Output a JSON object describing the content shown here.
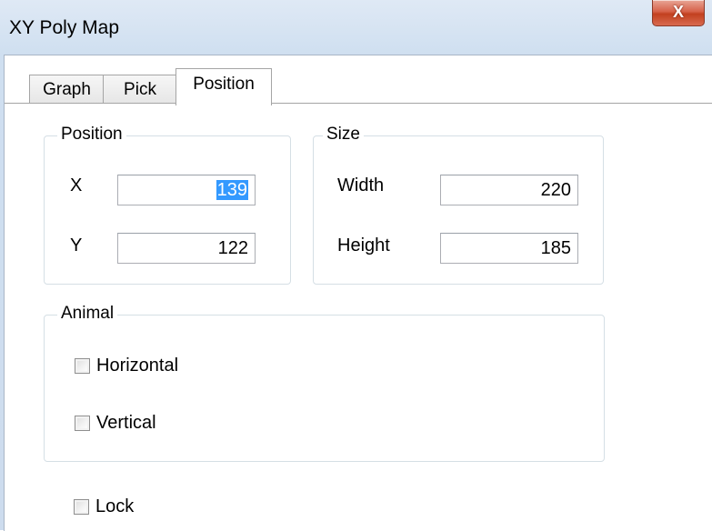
{
  "window": {
    "title": "XY Poly Map",
    "close_glyph": "X"
  },
  "tabs": [
    {
      "label": "Graph",
      "active": false
    },
    {
      "label": "Pick",
      "active": false
    },
    {
      "label": "Position",
      "active": true
    }
  ],
  "position_group": {
    "label": "Position",
    "x_label": "X",
    "x_value": "139",
    "y_label": "Y",
    "y_value": "122"
  },
  "size_group": {
    "label": "Size",
    "width_label": "Width",
    "width_value": "220",
    "height_label": "Height",
    "height_value": "185"
  },
  "animal_group": {
    "label": "Animal",
    "horizontal_label": "Horizontal",
    "horizontal_checked": false,
    "vertical_label": "Vertical",
    "vertical_checked": false
  },
  "lock": {
    "label": "Lock",
    "checked": false
  },
  "colors": {
    "selection": "#3399ff",
    "close_button": "#c2401f"
  }
}
